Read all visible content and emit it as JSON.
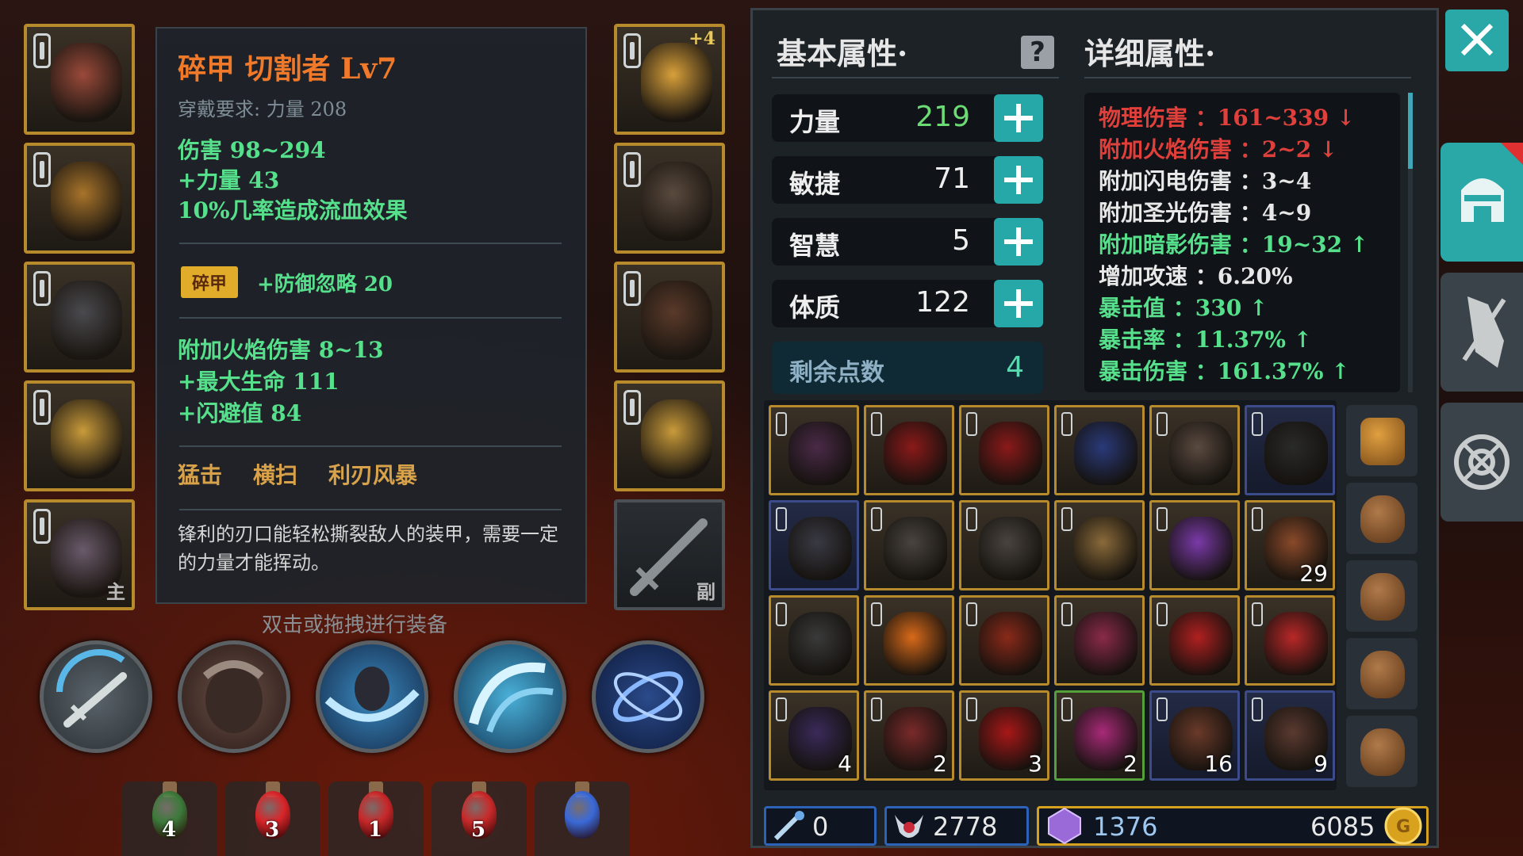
{
  "equipment_left": [
    {
      "name": "helmet",
      "corner": ""
    },
    {
      "name": "chest-armor",
      "corner": ""
    },
    {
      "name": "shoulder-armor",
      "corner": ""
    },
    {
      "name": "ring",
      "corner": ""
    },
    {
      "name": "main-weapon",
      "corner": "主"
    }
  ],
  "equipment_right": [
    {
      "name": "necklace",
      "plus": "+4",
      "corner": ""
    },
    {
      "name": "gloves",
      "corner": ""
    },
    {
      "name": "boots",
      "corner": ""
    },
    {
      "name": "ring-2",
      "corner": ""
    },
    {
      "name": "offhand-sword",
      "corner": "副"
    }
  ],
  "tooltip": {
    "title": "碎甲  切割者  Lv7",
    "requirement": "穿戴要求:  力量 208",
    "base_lines": [
      "伤害   98~294",
      "+力量 43",
      "10%几率造成流血效果"
    ],
    "badge": "碎甲",
    "badge_effect": "+防御忽略 20",
    "extra_lines": [
      "附加火焰伤害  8~13",
      "+最大生命  111",
      "+闪避值  84"
    ],
    "skills": "猛击    横扫    利刃风暴",
    "description": "锋利的刃口能轻松撕裂敌人的装甲，需要一定的力量才能挥动。"
  },
  "hint": "双击或拖拽进行装备",
  "potions": [
    {
      "count": "4",
      "color": "#3c7a3a"
    },
    {
      "count": "3",
      "color": "#d8262a"
    },
    {
      "count": "1",
      "color": "#c8282a"
    },
    {
      "count": "5",
      "color": "#c82a2a"
    },
    {
      "count": "",
      "color": "#3a6ad8"
    }
  ],
  "panel": {
    "basic_title": "基本属性·",
    "detail_title": "详细属性·",
    "stats": [
      {
        "label": "力量",
        "value": "219",
        "highlight": true
      },
      {
        "label": "敏捷",
        "value": "71",
        "highlight": false
      },
      {
        "label": "智慧",
        "value": "5",
        "highlight": false
      },
      {
        "label": "体质",
        "value": "122",
        "highlight": false
      }
    ],
    "remaining_label": "剩余点数",
    "remaining_value": "4",
    "details": [
      {
        "text": "物理伤害 ：161~339 ↓",
        "color": "#e0403c"
      },
      {
        "text": "附加火焰伤害 ：2~2 ↓",
        "color": "#e0403c"
      },
      {
        "text": "附加闪电伤害 ：3~4",
        "color": "#e8e8e8"
      },
      {
        "text": "附加圣光伤害 ：4~9",
        "color": "#e8e8e8"
      },
      {
        "text": "附加暗影伤害 ：19~32 ↑",
        "color": "#57e08c"
      },
      {
        "text": "增加攻速 ：6.20%",
        "color": "#e8e8e8"
      },
      {
        "text": "暴击值 ：330 ↑",
        "color": "#57e08c"
      },
      {
        "text": "暴击率 ：11.37% ↑",
        "color": "#57e08c"
      },
      {
        "text": "暴击伤害 ：161.37% ↑",
        "color": "#57e08c"
      }
    ]
  },
  "inventory": [
    {
      "item": "bow",
      "qty": "",
      "border": "gold",
      "color": "#4a2a48"
    },
    {
      "item": "red-axe",
      "qty": "",
      "border": "gold",
      "color": "#8a1a1a"
    },
    {
      "item": "red-axe-2",
      "qty": "",
      "border": "gold",
      "color": "#8a1a1a"
    },
    {
      "item": "blue-claw",
      "qty": "",
      "border": "gold",
      "color": "#2a3a7a"
    },
    {
      "item": "battle-axe",
      "qty": "",
      "border": "gold",
      "color": "#5a4a40"
    },
    {
      "item": "scythe",
      "qty": "",
      "border": "blue",
      "color": "#2a2a2a"
    },
    {
      "item": "spiked-mace",
      "qty": "",
      "border": "blue",
      "color": "#3a3a44"
    },
    {
      "item": "double-axe",
      "qty": "",
      "border": "gold",
      "color": "#4a4440"
    },
    {
      "item": "double-axe-2",
      "qty": "",
      "border": "gold",
      "color": "#4a4440"
    },
    {
      "item": "leather-bag",
      "qty": "",
      "border": "gold",
      "color": "#8a6a3a"
    },
    {
      "item": "purple-potion",
      "qty": "",
      "border": "gold",
      "color": "#7a3aa8"
    },
    {
      "item": "swirl-orb",
      "qty": "29",
      "border": "gold",
      "color": "#8a4a2a"
    },
    {
      "item": "coal-ore",
      "qty": "",
      "border": "gold",
      "color": "#3a3a3a"
    },
    {
      "item": "fire-crystal",
      "qty": "",
      "border": "gold",
      "color": "#d86a1a"
    },
    {
      "item": "red-feather",
      "qty": "",
      "border": "gold",
      "color": "#8a2a1a"
    },
    {
      "item": "flesh-ball",
      "qty": "",
      "border": "gold",
      "color": "#8a2a4a"
    },
    {
      "item": "red-scale",
      "qty": "",
      "border": "gold",
      "color": "#b02020"
    },
    {
      "item": "red-egg",
      "qty": "",
      "border": "gold",
      "color": "#b82828"
    },
    {
      "item": "dark-ore",
      "qty": "4",
      "border": "gold",
      "color": "#3a2a5a"
    },
    {
      "item": "red-rock",
      "qty": "2",
      "border": "gold",
      "color": "#7a2a2a"
    },
    {
      "item": "red-crystal",
      "qty": "3",
      "border": "gold",
      "color": "#a81818"
    },
    {
      "item": "pink-beast",
      "qty": "2",
      "border": "green",
      "color": "#a82a78"
    },
    {
      "item": "brown-fur",
      "qty": "16",
      "border": "blue",
      "color": "#6a3a2a"
    },
    {
      "item": "dark-fur",
      "qty": "9",
      "border": "blue",
      "color": "#5a3a30"
    }
  ],
  "side_bags": [
    "backpack",
    "small-bag",
    "pouch",
    "pouch",
    "pouch"
  ],
  "currency": {
    "keys": "0",
    "souls": "2778",
    "gems": "1376",
    "gold": "6085"
  }
}
